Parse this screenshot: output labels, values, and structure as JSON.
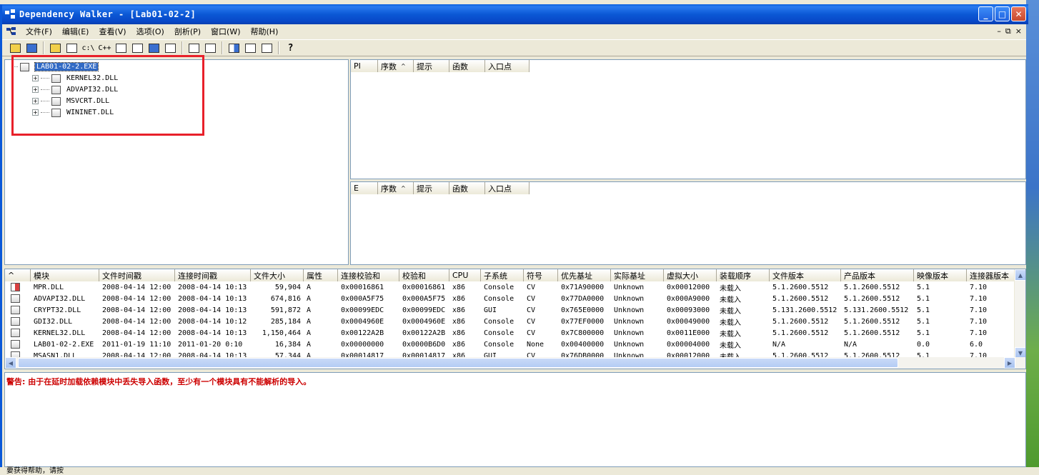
{
  "window": {
    "title": "Dependency Walker - [Lab01-02-2]",
    "minimize_glyph": "_",
    "maximize_glyph": "□",
    "close_glyph": "✕"
  },
  "menu": {
    "items": [
      "文件(F)",
      "编辑(E)",
      "查看(V)",
      "选项(O)",
      "剖析(P)",
      "窗口(W)",
      "帮助(H)"
    ],
    "mdi_minimize": "–",
    "mdi_restore": "⧉",
    "mdi_close": "×"
  },
  "toolbar": {
    "cpath_label": "c:\\",
    "cpp_label": "C++",
    "help_label": "?"
  },
  "tree": {
    "root": "LAB01-02-2.EXE",
    "children": [
      "KERNEL32.DLL",
      "ADVAPI32.DLL",
      "MSVCRT.DLL",
      "WININET.DLL"
    ]
  },
  "parent_imports": {
    "columns": [
      "PI",
      "序数",
      "提示",
      "函数",
      "入口点"
    ]
  },
  "exports": {
    "columns": [
      "E",
      "序数",
      "提示",
      "函数",
      "入口点"
    ]
  },
  "modules": {
    "columns": [
      "^",
      "模块",
      "文件时间戳",
      "连接时间戳",
      "文件大小",
      "属性",
      "连接校验和",
      "校验和",
      "CPU",
      "子系统",
      "符号",
      "优先基址",
      "实际基址",
      "虚拟大小",
      "装载顺序",
      "文件版本",
      "产品版本",
      "映像版本",
      "连接器版本"
    ],
    "rows": [
      [
        "MPR.DLL",
        "2008-04-14 12:00",
        "2008-04-14 10:13",
        "59,904",
        "A",
        "0x00016861",
        "0x00016861",
        "x86",
        "Console",
        "CV",
        "0x71A90000",
        "Unknown",
        "0x00012000",
        "未载入",
        "5.1.2600.5512",
        "5.1.2600.5512",
        "5.1",
        "7.10"
      ],
      [
        "ADVAPI32.DLL",
        "2008-04-14 12:00",
        "2008-04-14 10:13",
        "674,816",
        "A",
        "0x000A5F75",
        "0x000A5F75",
        "x86",
        "Console",
        "CV",
        "0x77DA0000",
        "Unknown",
        "0x000A9000",
        "未载入",
        "5.1.2600.5512",
        "5.1.2600.5512",
        "5.1",
        "7.10"
      ],
      [
        "CRYPT32.DLL",
        "2008-04-14 12:00",
        "2008-04-14 10:13",
        "591,872",
        "A",
        "0x00099EDC",
        "0x00099EDC",
        "x86",
        "GUI",
        "CV",
        "0x765E0000",
        "Unknown",
        "0x00093000",
        "未载入",
        "5.131.2600.5512",
        "5.131.2600.5512",
        "5.1",
        "7.10"
      ],
      [
        "GDI32.DLL",
        "2008-04-14 12:00",
        "2008-04-14 10:12",
        "285,184",
        "A",
        "0x0004960E",
        "0x0004960E",
        "x86",
        "Console",
        "CV",
        "0x77EF0000",
        "Unknown",
        "0x00049000",
        "未载入",
        "5.1.2600.5512",
        "5.1.2600.5512",
        "5.1",
        "7.10"
      ],
      [
        "KERNEL32.DLL",
        "2008-04-14 12:00",
        "2008-04-14 10:13",
        "1,150,464",
        "A",
        "0x00122A2B",
        "0x00122A2B",
        "x86",
        "Console",
        "CV",
        "0x7C800000",
        "Unknown",
        "0x0011E000",
        "未载入",
        "5.1.2600.5512",
        "5.1.2600.5512",
        "5.1",
        "7.10"
      ],
      [
        "LAB01-02-2.EXE",
        "2011-01-19 11:10",
        "2011-01-20  0:10",
        "16,384",
        "A",
        "0x00000000",
        "0x0000B6D0",
        "x86",
        "Console",
        "None",
        "0x00400000",
        "Unknown",
        "0x00004000",
        "未载入",
        "N/A",
        "N/A",
        "0.0",
        "6.0"
      ],
      [
        "MSASN1.DLL",
        "2008-04-14 12:00",
        "2008-04-14 10:13",
        "57,344",
        "A",
        "0x00014817",
        "0x00014817",
        "x86",
        "GUI",
        "CV",
        "0x76DB0000",
        "Unknown",
        "0x00012000",
        "未载入",
        "5.1.2600.5512",
        "5.1.2600.5512",
        "5.1",
        "7.10"
      ]
    ]
  },
  "log": {
    "warning": "警告: 由于在延时加载依赖模块中丢失导入函数，至少有一个模块具有不能解析的导入。"
  },
  "status": {
    "text": "要获得帮助，请按"
  },
  "colors": {
    "title_bar": "#0B58D5",
    "selection": "#316AC5",
    "warning": "#CC0000",
    "annotation_box": "#E8202A"
  }
}
